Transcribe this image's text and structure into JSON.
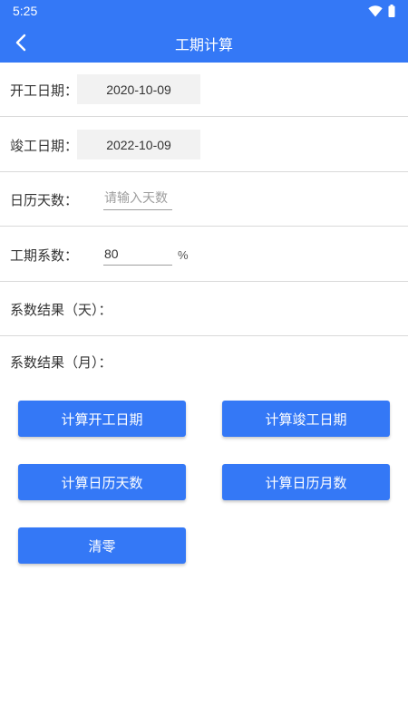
{
  "status_bar": {
    "time": "5:25",
    "icons": [
      "wifi-icon",
      "battery-icon"
    ]
  },
  "app_bar": {
    "title": "工期计算",
    "back_icon": "chevron-left-icon"
  },
  "form": {
    "start_date": {
      "label": "开工日期：",
      "value": "2020-10-09"
    },
    "end_date": {
      "label": "竣工日期：",
      "value": "2022-10-09"
    },
    "calendar_days": {
      "label": "日历天数：",
      "placeholder": "请输入天数",
      "value": ""
    },
    "coefficient": {
      "label": "工期系数：",
      "value": "80",
      "unit": "%"
    },
    "result_days": {
      "label": "系数结果（天）：",
      "value": ""
    },
    "result_months": {
      "label": "系数结果（月）：",
      "value": ""
    }
  },
  "buttons": {
    "calc_start": "计算开工日期",
    "calc_end": "计算竣工日期",
    "calc_days": "计算日历天数",
    "calc_months": "计算日历月数",
    "clear": "清零"
  },
  "colors": {
    "primary": "#3478f6",
    "divider": "#d9d9d9",
    "field_bg": "#f2f2f2"
  }
}
